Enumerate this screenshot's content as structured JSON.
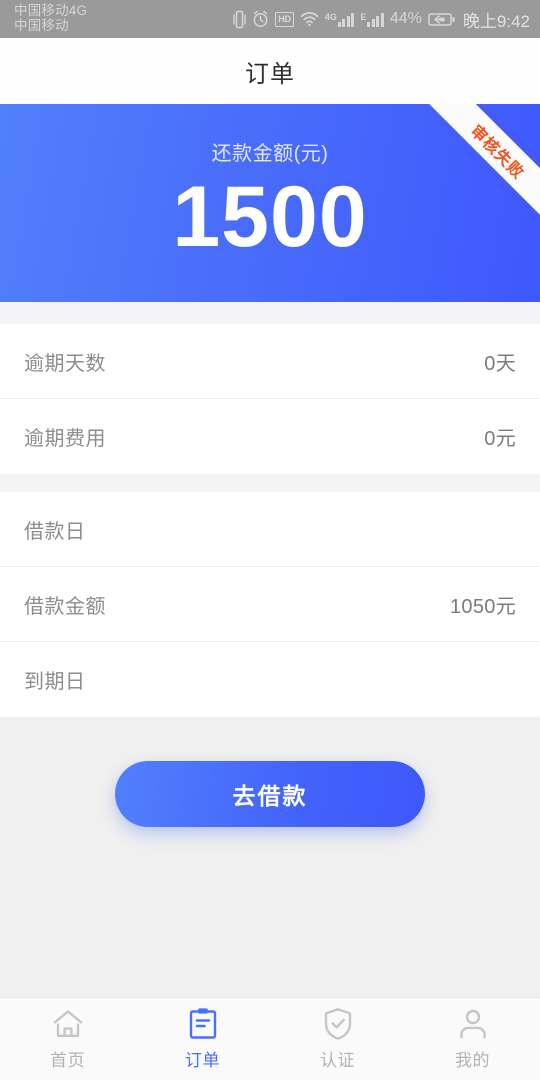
{
  "status_bar": {
    "carrier_line1": "中国移动4G",
    "carrier_line2": "中国移动",
    "hd_label": "HD",
    "signal1_tag": "4G",
    "signal2_tag": "E",
    "battery_percent": "44%",
    "time": "晚上9:42",
    "icons": [
      "vibrate-icon",
      "alarm-icon",
      "hd-icon",
      "wifi-icon",
      "signal-4g-icon",
      "signal-e-icon",
      "battery-charging-icon"
    ]
  },
  "header": {
    "title": "订单"
  },
  "hero": {
    "label": "还款金额(元)",
    "amount": "1500",
    "ribbon_text": "审核失败",
    "gradient_start": "#5180fb",
    "gradient_end": "#3f57fc",
    "ribbon_color": "#f2511b"
  },
  "details": {
    "group1": [
      {
        "label": "逾期天数",
        "value": "0天"
      },
      {
        "label": "逾期费用",
        "value": "0元"
      }
    ],
    "group2": [
      {
        "label": "借款日",
        "value": ""
      },
      {
        "label": "借款金额",
        "value": "1050元"
      },
      {
        "label": "到期日",
        "value": ""
      }
    ]
  },
  "cta": {
    "label": "去借款"
  },
  "tabbar": {
    "active_color": "#4a6ffb",
    "inactive_color": "#b3b3b3",
    "items": [
      {
        "label": "首页",
        "icon": "home-icon",
        "active": false
      },
      {
        "label": "订单",
        "icon": "clipboard-icon",
        "active": true
      },
      {
        "label": "认证",
        "icon": "shield-check-icon",
        "active": false
      },
      {
        "label": "我的",
        "icon": "person-icon",
        "active": false
      }
    ]
  }
}
